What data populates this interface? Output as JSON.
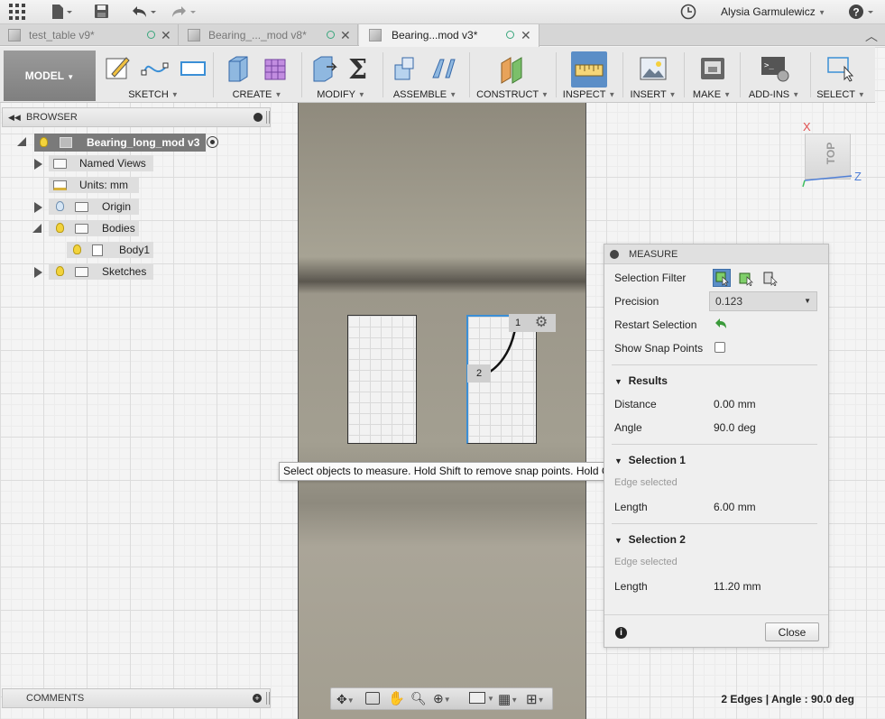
{
  "user": {
    "name": "Alysia Garmulewicz"
  },
  "tabs": [
    {
      "label": "test_table v9*",
      "active": false
    },
    {
      "label": "Bearing_..._mod v8*",
      "active": false
    },
    {
      "label": "Bearing...mod v3*",
      "active": true
    }
  ],
  "toolbar": {
    "model_label": "MODEL",
    "groups": [
      "SKETCH",
      "CREATE",
      "MODIFY",
      "ASSEMBLE",
      "CONSTRUCT",
      "INSPECT",
      "INSERT",
      "MAKE",
      "ADD-INS",
      "SELECT"
    ]
  },
  "browser": {
    "title": "BROWSER",
    "root": "Bearing_long_mod v3",
    "items": [
      "Named Views",
      "Units: mm",
      "Origin",
      "Bodies",
      "Body1",
      "Sketches"
    ]
  },
  "viewcube": {
    "face": "TOP",
    "axis_x": "X",
    "axis_z": "Z"
  },
  "viewport": {
    "callout_1": "1",
    "callout_2": "2"
  },
  "tooltip": "Select objects to measure. Hold Shift to remove snap points. Hold Cmd to lock snap points.",
  "measure": {
    "title": "MEASURE",
    "selection_filter_label": "Selection Filter",
    "precision_label": "Precision",
    "precision_value": "0.123",
    "restart_label": "Restart Selection",
    "snap_label": "Show Snap Points",
    "results_title": "Results",
    "distance_label": "Distance",
    "distance_value": "0.00 mm",
    "angle_label": "Angle",
    "angle_value": "90.0 deg",
    "sel1_title": "Selection 1",
    "sel1_sub": "Edge selected",
    "sel1_length_label": "Length",
    "sel1_length_value": "6.00 mm",
    "sel2_title": "Selection 2",
    "sel2_sub": "Edge selected",
    "sel2_length_label": "Length",
    "sel2_length_value": "11.20 mm",
    "close_label": "Close"
  },
  "comments": {
    "title": "COMMENTS"
  },
  "status": "2 Edges | Angle : 90.0 deg",
  "colors": {
    "accent_blue": "#3b8fd6",
    "inspect_active": "#5b8ec7",
    "restart_green": "#3a9a3a"
  }
}
